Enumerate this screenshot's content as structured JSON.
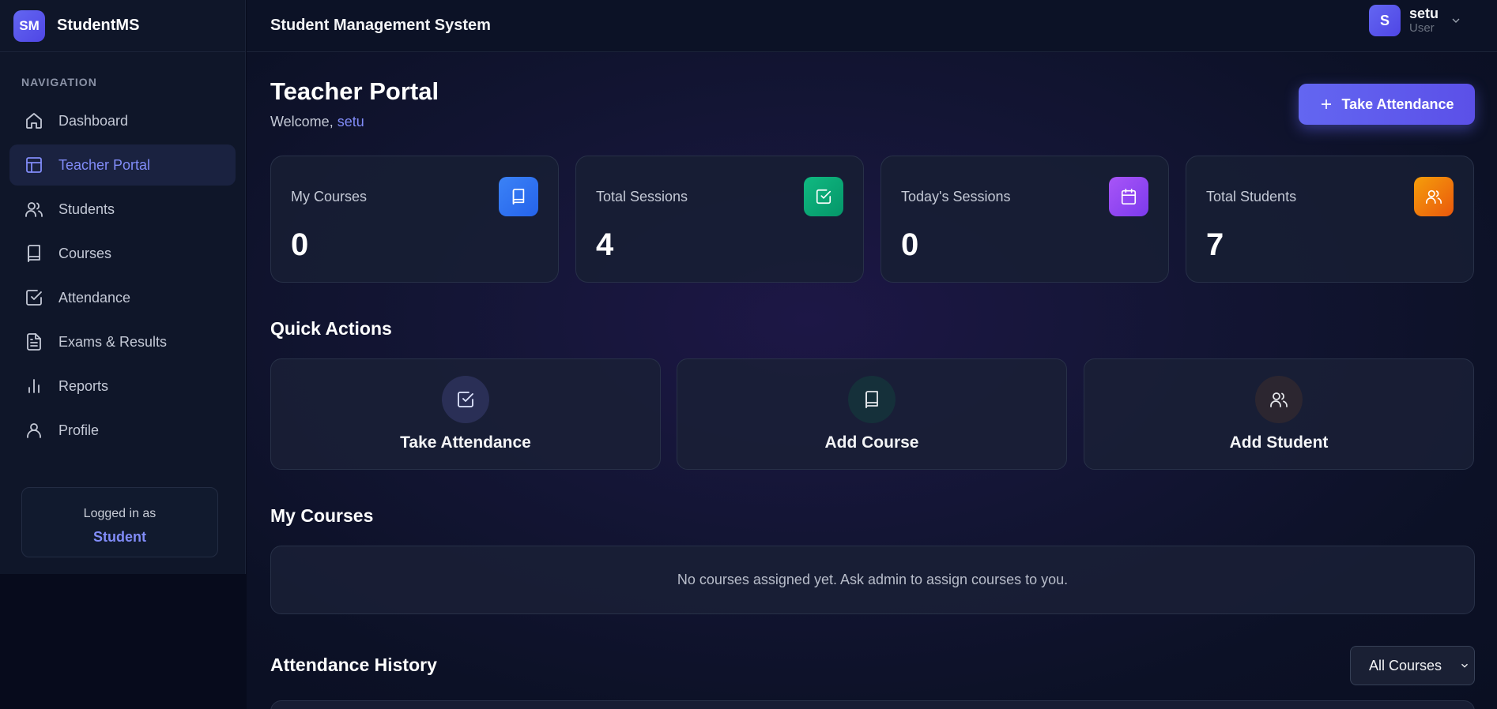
{
  "brand": {
    "logo": "SM",
    "name": "StudentMS"
  },
  "sidebar": {
    "heading": "NAVIGATION",
    "items": [
      {
        "label": "Dashboard",
        "icon": "home-icon",
        "active": false
      },
      {
        "label": "Teacher Portal",
        "icon": "layout-icon",
        "active": true
      },
      {
        "label": "Students",
        "icon": "users-icon",
        "active": false
      },
      {
        "label": "Courses",
        "icon": "book-icon",
        "active": false
      },
      {
        "label": "Attendance",
        "icon": "check-square-icon",
        "active": false
      },
      {
        "label": "Exams & Results",
        "icon": "file-text-icon",
        "active": false
      },
      {
        "label": "Reports",
        "icon": "bar-chart-icon",
        "active": false
      },
      {
        "label": "Profile",
        "icon": "user-icon",
        "active": false
      }
    ],
    "login_box": {
      "caption": "Logged in as",
      "role": "Student"
    }
  },
  "topbar": {
    "title": "Student Management System",
    "user": {
      "initial": "S",
      "name": "setu",
      "role": "User"
    }
  },
  "page": {
    "title": "Teacher Portal",
    "welcome_prefix": "Welcome, ",
    "welcome_name": "setu",
    "primary_button": "Take Attendance"
  },
  "stats": [
    {
      "label": "My Courses",
      "value": "0",
      "icon": "book-icon",
      "color": "#2563eb"
    },
    {
      "label": "Total Sessions",
      "value": "4",
      "icon": "check-square-icon",
      "color": "#059669"
    },
    {
      "label": "Today's Sessions",
      "value": "0",
      "icon": "calendar-icon",
      "color": "#7c3aed"
    },
    {
      "label": "Total Students",
      "value": "7",
      "icon": "users-icon",
      "color": "#ea580c"
    }
  ],
  "quick_actions": {
    "title": "Quick Actions",
    "items": [
      {
        "label": "Take Attendance",
        "icon": "check-square-icon"
      },
      {
        "label": "Add Course",
        "icon": "book-icon"
      },
      {
        "label": "Add Student",
        "icon": "users-icon"
      }
    ]
  },
  "my_courses": {
    "title": "My Courses",
    "empty_text": "No courses assigned yet. Ask admin to assign courses to you."
  },
  "attendance_history": {
    "title": "Attendance History",
    "filter": "All Courses"
  }
}
